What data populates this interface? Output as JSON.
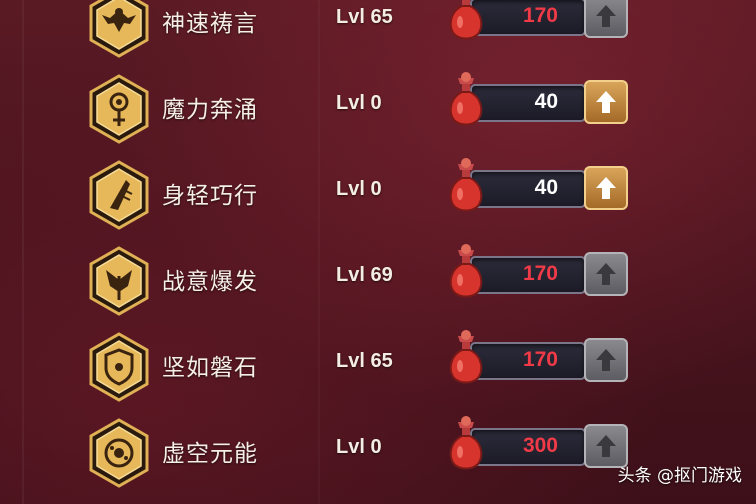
{
  "skills": [
    {
      "name": "神速祷言",
      "level": "Lvl 65",
      "cost": "170",
      "cost_affordable": false,
      "upgrade_available": false,
      "icon": "wings-emblem-icon"
    },
    {
      "name": "魔力奔涌",
      "level": "Lvl 0",
      "cost": "40",
      "cost_affordable": true,
      "upgrade_available": true,
      "icon": "magic-staff-icon"
    },
    {
      "name": "身轻巧行",
      "level": "Lvl 0",
      "cost": "40",
      "cost_affordable": true,
      "upgrade_available": true,
      "icon": "swift-feather-icon"
    },
    {
      "name": "战意爆发",
      "level": "Lvl 69",
      "cost": "170",
      "cost_affordable": false,
      "upgrade_available": false,
      "icon": "battle-axe-icon"
    },
    {
      "name": "坚如磐石",
      "level": "Lvl 65",
      "cost": "170",
      "cost_affordable": false,
      "upgrade_available": false,
      "icon": "shield-icon"
    },
    {
      "name": "虚空元能",
      "level": "Lvl 0",
      "cost": "300",
      "cost_affordable": false,
      "upgrade_available": false,
      "icon": "void-orb-icon"
    }
  ],
  "colors": {
    "cost_unaffordable": "#f03a47",
    "cost_affordable": "#ffffff",
    "hex_gold": "#e0b055",
    "background": "#4a141e"
  },
  "watermark": "头条 @抠门游戏"
}
